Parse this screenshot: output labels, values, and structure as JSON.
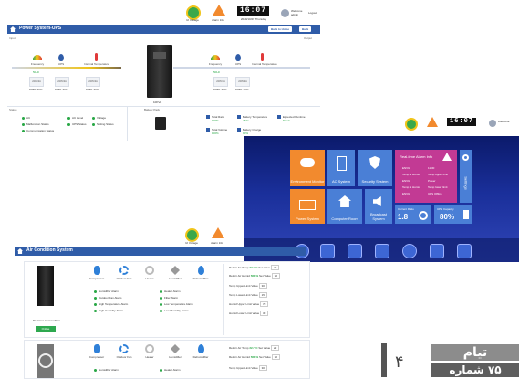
{
  "ups": {
    "title": "Power System-UPS",
    "clock": "16:07",
    "date_text": "2019/10/26 Thursday",
    "status_items": [
      {
        "label": "UI Voltage"
      },
      {
        "label": "Alarm Info"
      }
    ],
    "user": {
      "name": "Welcome",
      "sub": "admin",
      "logout": "Logout"
    },
    "buttons": [
      "Back to Home",
      "Back"
    ],
    "input_label": "Input",
    "output_label": "Output",
    "left_sensors": [
      {
        "label": "Frequency",
        "value": "50Hz"
      },
      {
        "label": "UPS"
      },
      {
        "label": "Internal Temperature",
        "value": "25°C"
      }
    ],
    "right_sensors": [
      {
        "label": "Frequency",
        "value": "50Hz"
      },
      {
        "label": "UPS"
      },
      {
        "label": "Internal Temperature",
        "value": "25°C"
      }
    ],
    "left_boxes": [
      "220V/2A",
      "220V/2A",
      "220V/2A"
    ],
    "right_boxes": [
      "220V/2A",
      "220V/2A"
    ],
    "load_labels": [
      "Load: 33%",
      "Load: 33%",
      "Load: 33%",
      "Load: 33%",
      "Load: 33%"
    ],
    "device_label": "10KVA",
    "status_title": "Status",
    "status_col1": [
      "AC",
      "Malfunction Status",
      "Communication Status"
    ],
    "status_col2": [
      "AC Level",
      "UPS Status"
    ],
    "status_col3": [
      "Voltage",
      "Setting Status"
    ],
    "battery_title": "Battery Pack",
    "battery_items": [
      {
        "label": "Total Ratio",
        "value": "100%"
      },
      {
        "label": "Battery Temperature",
        "value": "25°C"
      },
      {
        "label": "Expected Runtime",
        "value": "60min"
      },
      {
        "label": "Total Volume",
        "value": "100%"
      },
      {
        "label": "Battery Charge",
        "value": "90%"
      }
    ]
  },
  "dashboard": {
    "tiles": [
      {
        "label": "Environment Monitor"
      },
      {
        "label": "AC System"
      },
      {
        "label": "Security System"
      },
      {
        "label": "Power System"
      },
      {
        "label": "Computer Room"
      },
      {
        "label": "Broadcast System"
      }
    ],
    "alarm": {
      "title": "Real-time Alarm Info",
      "rows": [
        {
          "a": "ENVIL",
          "b": "11:30"
        },
        {
          "a": "Temp & Humid",
          "b": "Temp upper limit"
        },
        {
          "a": "ENVIL",
          "b": "Power"
        },
        {
          "a": "Temp & Humid",
          "b": "Temp lower limit"
        },
        {
          "a": "ENVIL",
          "b": "UPS Offline"
        }
      ]
    },
    "current": {
      "label": "Current Ratio",
      "value": "1.8"
    },
    "ups_capacity": {
      "label": "UPS Capacity",
      "value": "80%"
    },
    "settings_label": "Settings"
  },
  "ac": {
    "title": "Air Condition System",
    "clock": "16:07",
    "status_items": [
      "UI Voltage",
      "Alarm Info"
    ],
    "user": {
      "name": "Welcome",
      "sub": "admin",
      "logout": "Logout"
    },
    "unit_label": "Precision Air Condition",
    "unit_button": "Online",
    "icons": [
      "Compressor",
      "Outdoor Fan",
      "Heater",
      "Humidifier",
      "Dehumidifier"
    ],
    "statuses_left": [
      "Humidifier Alarm",
      "Outdoor Fan Alarm",
      "High Temperature Alarm",
      "High Humidity Alarm"
    ],
    "statuses_right": [
      "Heater Alarm",
      "Filter Alarm",
      "Low Temperature Alarm",
      "Low Humidity Alarm"
    ],
    "settings": [
      {
        "label": "Return Air Temp",
        "value": "22.2°C",
        "label2": "Set Value",
        "value2": "22"
      },
      {
        "label": "Return Air Humid",
        "value": "56.1%",
        "label2": "Set Value",
        "value2": "50"
      },
      {
        "label": "Temp Upper Limit Value",
        "value": "30"
      },
      {
        "label": "Temp Lower Limit Value",
        "value": "15"
      },
      {
        "label": "Humid Upper Limit Value",
        "value": "70"
      },
      {
        "label": "Humid Lower Limit Value",
        "value": "30"
      }
    ]
  },
  "sticker": {
    "line1": "تیام",
    "line2": "۷۵ شماره",
    "page_number": "۴"
  },
  "colors": {
    "brand_blue": "#2f5ca8",
    "dash_blue": "#1a2f9a",
    "tile_orange": "#f28a2e",
    "tile_blue": "#4a7fd6",
    "alarm_magenta": "#c23a94",
    "ok_green": "#28a745"
  }
}
